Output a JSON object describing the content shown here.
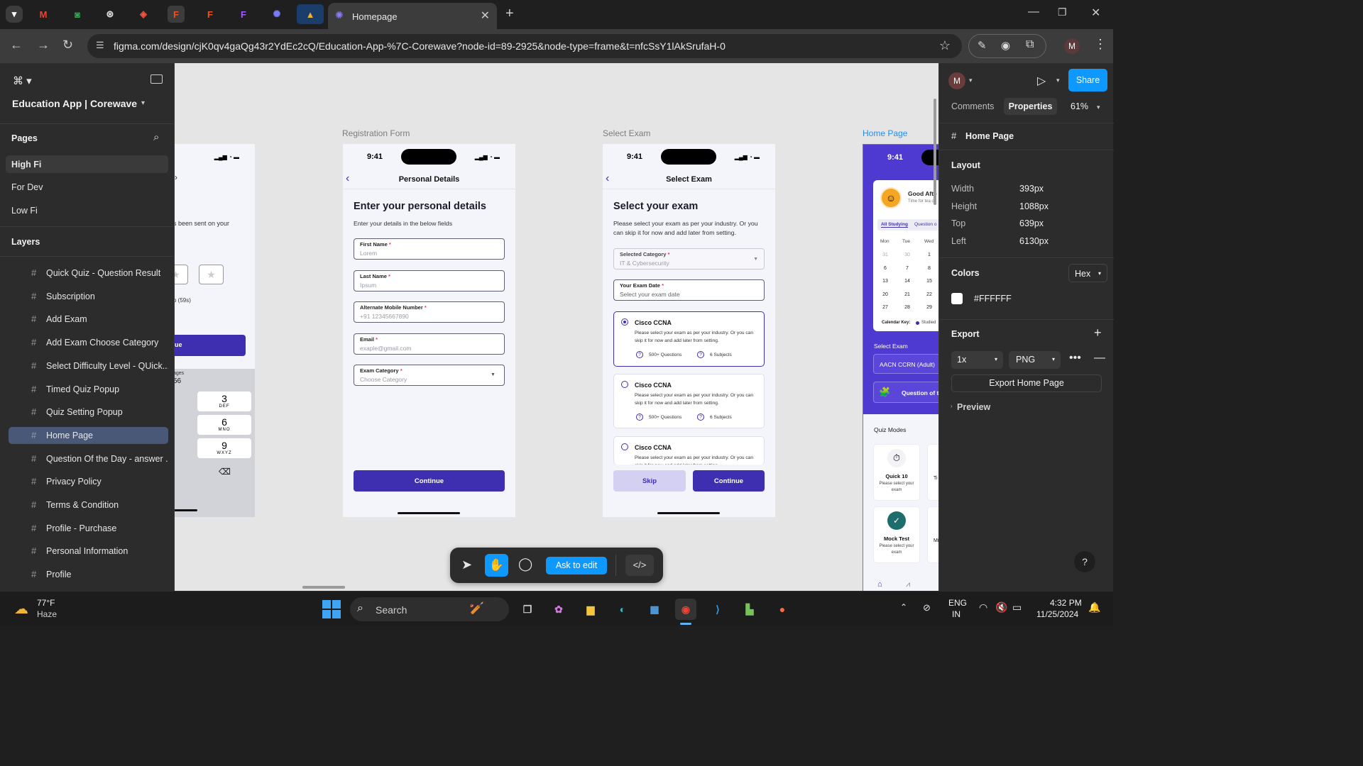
{
  "browser": {
    "tab_title": "Homepage",
    "url": "figma.com/design/cjK0qv4gaQg43r2YdEc2cQ/Education-App-%7C-Corewave?node-id=89-2925&node-type=frame&t=nfcSsY1lAkSrufaH-0",
    "profile_initial": "M"
  },
  "left_panel": {
    "file_name": "Education App | Corewave",
    "pages_heading": "Pages",
    "pages": [
      "High Fi",
      "For Dev",
      "Low Fi"
    ],
    "layers_heading": "Layers",
    "layers": [
      "Quick Quiz - Question Result",
      "Subscription",
      "Add Exam",
      "Add Exam Choose Category",
      "Select Difficulty Level - QUick...",
      "Timed Quiz Popup",
      "Quiz Setting Popup",
      "Home Page",
      "Question Of the Day - answer ...",
      "Privacy Policy",
      "Terms & Condition",
      "Profile - Purchase",
      "Personal Information",
      "Profile"
    ],
    "selected_layer": "Home Page"
  },
  "canvas": {
    "frame_labels": [
      "Registration Form",
      "Select Exam",
      "Home Page"
    ],
    "partial_frame": {
      "sent_text": "s been sent on your",
      "continue_text": "ue",
      "resend_text": "p (59s)",
      "messages_label": "ages",
      "messages_count": "56",
      "keys": [
        {
          "num": "3",
          "letters": "DEF"
        },
        {
          "num": "6",
          "letters": "MNO"
        },
        {
          "num": "9",
          "letters": "WXYZ"
        }
      ]
    },
    "registration": {
      "time": "9:41",
      "nav_title": "Personal  Details",
      "heading": "Enter your personal details",
      "subtitle": "Enter your details in the below fields",
      "fields": [
        {
          "label": "First Name",
          "value": "Lorem"
        },
        {
          "label": "Last Name",
          "value": "Ipsum"
        },
        {
          "label": "Alternate Mobile Number",
          "value": "+91 12345667890"
        },
        {
          "label": "Email",
          "value": "exaple@gmail.com"
        },
        {
          "label": "Exam Category",
          "value": "Choose Category"
        }
      ],
      "continue": "Continue"
    },
    "select_exam": {
      "time": "9:41",
      "nav_title": "Select Exam",
      "heading": "Select your exam",
      "subtitle": "Please select your exam as per your industry. Or you can skip it for now and add later from setting.",
      "category_label": "Selected Category",
      "category_value": "IT & Cybersecurity",
      "date_label": "Your Exam Date",
      "date_value": "Select your exam date",
      "exams": [
        {
          "name": "Cisco CCNA",
          "desc": "Please select your exam as per your industry. Or you can skip it for now and add later from setting.",
          "questions": "500+ Questions",
          "subjects": "6 Subjects"
        },
        {
          "name": "Cisco CCNA",
          "desc": "Please select your exam as per your industry. Or you can skip it for now and add later from setting.",
          "questions": "500+ Questions",
          "subjects": "6 Subjects"
        },
        {
          "name": "Cisco CCNA",
          "desc": "Please select your exam as per your industry. Or you can skip it for now and add later from setting."
        }
      ],
      "skip": "Skip",
      "continue": "Continue"
    },
    "home": {
      "time": "9:41",
      "greeting": "Good Afte",
      "greeting_sub": "Time for tea o",
      "tab_active": "All Studying",
      "tab_other": "Question o",
      "days": [
        "Mon",
        "Tue",
        "Wed"
      ],
      "calendar": [
        [
          "31",
          "30",
          "1"
        ],
        [
          "6",
          "7",
          "8"
        ],
        [
          "13",
          "14",
          "15"
        ],
        [
          "20",
          "21",
          "22"
        ],
        [
          "27",
          "28",
          "29"
        ]
      ],
      "calendar_key": "Calendar Key:",
      "calendar_key_item": "Studied",
      "select_exam_label": "Select Exam",
      "select_exam_value": "AACN CCRN (Adult)",
      "question_of_day": "Question of t",
      "quiz_modes_label": "Quiz Modes",
      "modes": [
        {
          "title": "Quick 10",
          "desc": "Please select your exam",
          "partial": "Ti"
        },
        {
          "title": "Mock Test",
          "desc": "Please select your exam",
          "partial": "Mi"
        }
      ]
    }
  },
  "toolbar": {
    "ask_to_edit": "Ask to edit"
  },
  "right_panel": {
    "user_initial": "M",
    "share": "Share",
    "tab_comments": "Comments",
    "tab_properties": "Properties",
    "zoom": "61%",
    "frame_name": "Home Page",
    "layout_heading": "Layout",
    "props": [
      {
        "key": "Width",
        "value": "393px"
      },
      {
        "key": "Height",
        "value": "1088px"
      },
      {
        "key": "Top",
        "value": "639px"
      },
      {
        "key": "Left",
        "value": "6130px"
      }
    ],
    "colors_heading": "Colors",
    "color_format": "Hex",
    "color_value": "#FFFFFF",
    "export_heading": "Export",
    "export_scale": "1x",
    "export_format": "PNG",
    "export_button": "Export Home Page",
    "preview": "Preview"
  },
  "taskbar": {
    "temperature": "77°F",
    "weather": "Haze",
    "search": "Search",
    "lang_line1": "ENG",
    "lang_line2": "IN",
    "time": "4:32 PM",
    "date": "11/25/2024"
  },
  "colors": {
    "accent": "#3d2fb0",
    "figma_blue": "#0d99ff",
    "canvas_bg": "#e5e5e5",
    "panel_bg": "#2c2c2c"
  }
}
